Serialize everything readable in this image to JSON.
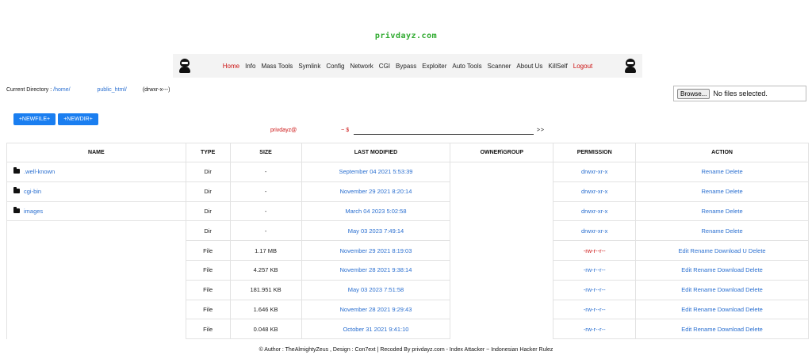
{
  "site": {
    "title": "privdayz.com"
  },
  "nav": {
    "items": [
      {
        "label": "Home",
        "color": "red"
      },
      {
        "label": "Info",
        "color": "dark"
      },
      {
        "label": "Mass Tools",
        "color": "dark"
      },
      {
        "label": "Symlink",
        "color": "dark"
      },
      {
        "label": "Config",
        "color": "dark"
      },
      {
        "label": "Network",
        "color": "dark"
      },
      {
        "label": "CGI",
        "color": "dark"
      },
      {
        "label": "Bypass",
        "color": "dark"
      },
      {
        "label": "Exploiter",
        "color": "dark"
      },
      {
        "label": "Auto Tools",
        "color": "dark"
      },
      {
        "label": "Scanner",
        "color": "dark"
      },
      {
        "label": "About Us",
        "color": "dark"
      },
      {
        "label": "KillSelf",
        "color": "dark"
      },
      {
        "label": "Logout",
        "color": "red"
      }
    ]
  },
  "current_dir": {
    "label": "Current Directory :",
    "path_home": "/home/",
    "path_public": "public_html/",
    "perms": "(drwxr-x---)"
  },
  "upload": {
    "browse_label": "Browse...",
    "status": "No files selected."
  },
  "buttons": {
    "newfile": "+NEWFILE+",
    "newdir": "+NEWDIR+"
  },
  "cmd": {
    "user": "privdayz@",
    "sep": "~ $",
    "go": ">>"
  },
  "table": {
    "headers": [
      "NAME",
      "TYPE",
      "SIZE",
      "LAST MODIFIED",
      "OWNER\\GROUP",
      "PERMISSION",
      "ACTION"
    ],
    "rows": [
      {
        "name": ".well-known",
        "folder": true,
        "type": "Dir",
        "size": "-",
        "modified": "September 04 2021 5:53:39",
        "perm": "drwxr-xr-x",
        "perm_color": "link",
        "action": "Rename Delete"
      },
      {
        "name": "cgi-bin",
        "folder": true,
        "type": "Dir",
        "size": "-",
        "modified": "November 29 2021 8:20:14",
        "perm": "drwxr-xr-x",
        "perm_color": "link",
        "action": "Rename Delete"
      },
      {
        "name": "images",
        "folder": true,
        "type": "Dir",
        "size": "-",
        "modified": "March 04 2023 5:02:58",
        "perm": "drwxr-xr-x",
        "perm_color": "link",
        "action": "Rename Delete"
      },
      {
        "name": "",
        "folder": false,
        "type": "Dir",
        "size": "-",
        "modified": "May 03 2023 7:49:14",
        "perm": "drwxr-xr-x",
        "perm_color": "link",
        "action": "Rename Delete"
      },
      {
        "name": "",
        "folder": false,
        "type": "File",
        "size": "1.17 MB",
        "modified": "November 29 2021 8:19:03",
        "perm": "-rw-r--r--",
        "perm_color": "red",
        "action": "Edit Rename Download U Delete"
      },
      {
        "name": "",
        "folder": false,
        "type": "File",
        "size": "4.257 KB",
        "modified": "November 28 2021 9:38:14",
        "perm": "-rw-r--r--",
        "perm_color": "link",
        "action": "Edit Rename Download Delete"
      },
      {
        "name": "",
        "folder": false,
        "type": "File",
        "size": "181.951 KB",
        "modified": "May 03 2023 7:51:58",
        "perm": "-rw-r--r--",
        "perm_color": "link",
        "action": "Edit Rename Download Delete"
      },
      {
        "name": "",
        "folder": false,
        "type": "File",
        "size": "1.646 KB",
        "modified": "November 28 2021 9:29:43",
        "perm": "-rw-r--r--",
        "perm_color": "link",
        "action": "Edit Rename Download Delete"
      },
      {
        "name": "",
        "folder": false,
        "type": "File",
        "size": "0.048 KB",
        "modified": "October 31 2021 9:41:10",
        "perm": "-rw-r--r--",
        "perm_color": "link",
        "action": "Edit Rename Download Delete"
      }
    ]
  },
  "footer": {
    "text": "© Author : TheAlmightyZeus , Design : Con7ext | Recoded By privdayz.com - Index Attacker ~ Indonesian Hacker Rulez"
  },
  "colors": {
    "accent_blue": "#1a7ef0",
    "link_blue": "#2a6fd0",
    "red": "#cc1111",
    "title_green": "#2faa2f"
  }
}
